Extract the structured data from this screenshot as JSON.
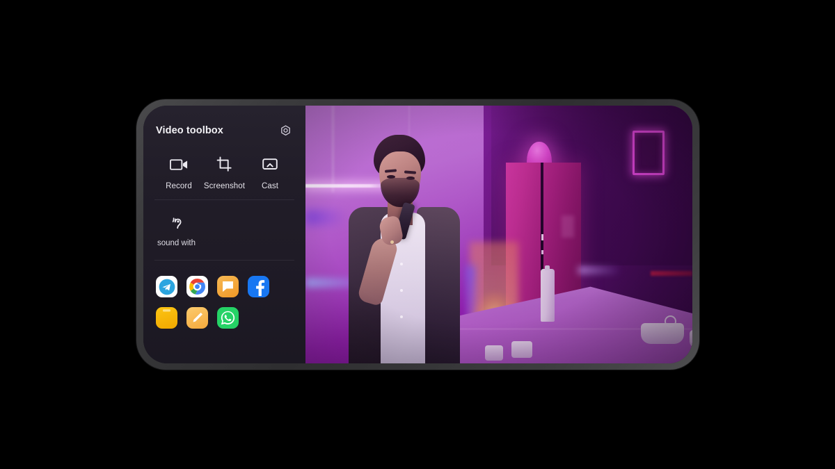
{
  "device": {
    "type": "smartphone-landscape",
    "frame_color": "#3a3a3c",
    "screen_bg": "#1b1822"
  },
  "toolbox": {
    "title": "Video toolbox",
    "settings_icon": "gear-hex-icon",
    "panel_bg": "#211d28",
    "actions": [
      {
        "label": "Record",
        "icon": "video-camera-icon"
      },
      {
        "label": "Screenshot",
        "icon": "crop-icon"
      },
      {
        "label": "Cast",
        "icon": "cast-screen-icon"
      }
    ],
    "sound": {
      "label": "sound with",
      "icon": "ear-sound-icon"
    },
    "app_rows": [
      [
        {
          "name": "Telegram",
          "icon": "telegram-icon",
          "bg": "#ffffff",
          "accent": "#2ca5e0"
        },
        {
          "name": "Chrome",
          "icon": "chrome-icon",
          "bg": "#ffffff",
          "accent": "#4285f4"
        },
        {
          "name": "Messages",
          "icon": "messages-icon",
          "bg": "#f5a623",
          "accent": "#ffffff"
        },
        {
          "name": "Facebook",
          "icon": "facebook-icon",
          "bg": "#1877f2",
          "accent": "#ffffff"
        }
      ],
      [
        {
          "name": "Files",
          "icon": "folder-icon",
          "bg": "#fbbc04",
          "accent": "#fdd663"
        },
        {
          "name": "Notes",
          "icon": "notes-pencil-icon",
          "bg": "#fbbf56",
          "accent": "#ffffff"
        },
        {
          "name": "WhatsApp",
          "icon": "whatsapp-icon",
          "bg": "#25d366",
          "accent": "#ffffff"
        }
      ]
    ]
  },
  "video": {
    "description": "Man in dark cardigan and white t-shirt holding a phone in a neon purple and magenta lit room",
    "scene": {
      "subject": "man-with-phone",
      "background": "purple-neon-room",
      "objects": [
        "magenta-cabinet",
        "table-lamp",
        "neon-picture-frame",
        "counter",
        "bottle",
        "jars",
        "bowls"
      ]
    },
    "palette": {
      "primary": "#a93fbf",
      "accent_magenta": "#e94ae0",
      "deep_purple": "#3e0a4e",
      "light_wall": "#c077d6",
      "neon_blue": "#4678ff",
      "warm_glow": "#f2b078"
    }
  }
}
